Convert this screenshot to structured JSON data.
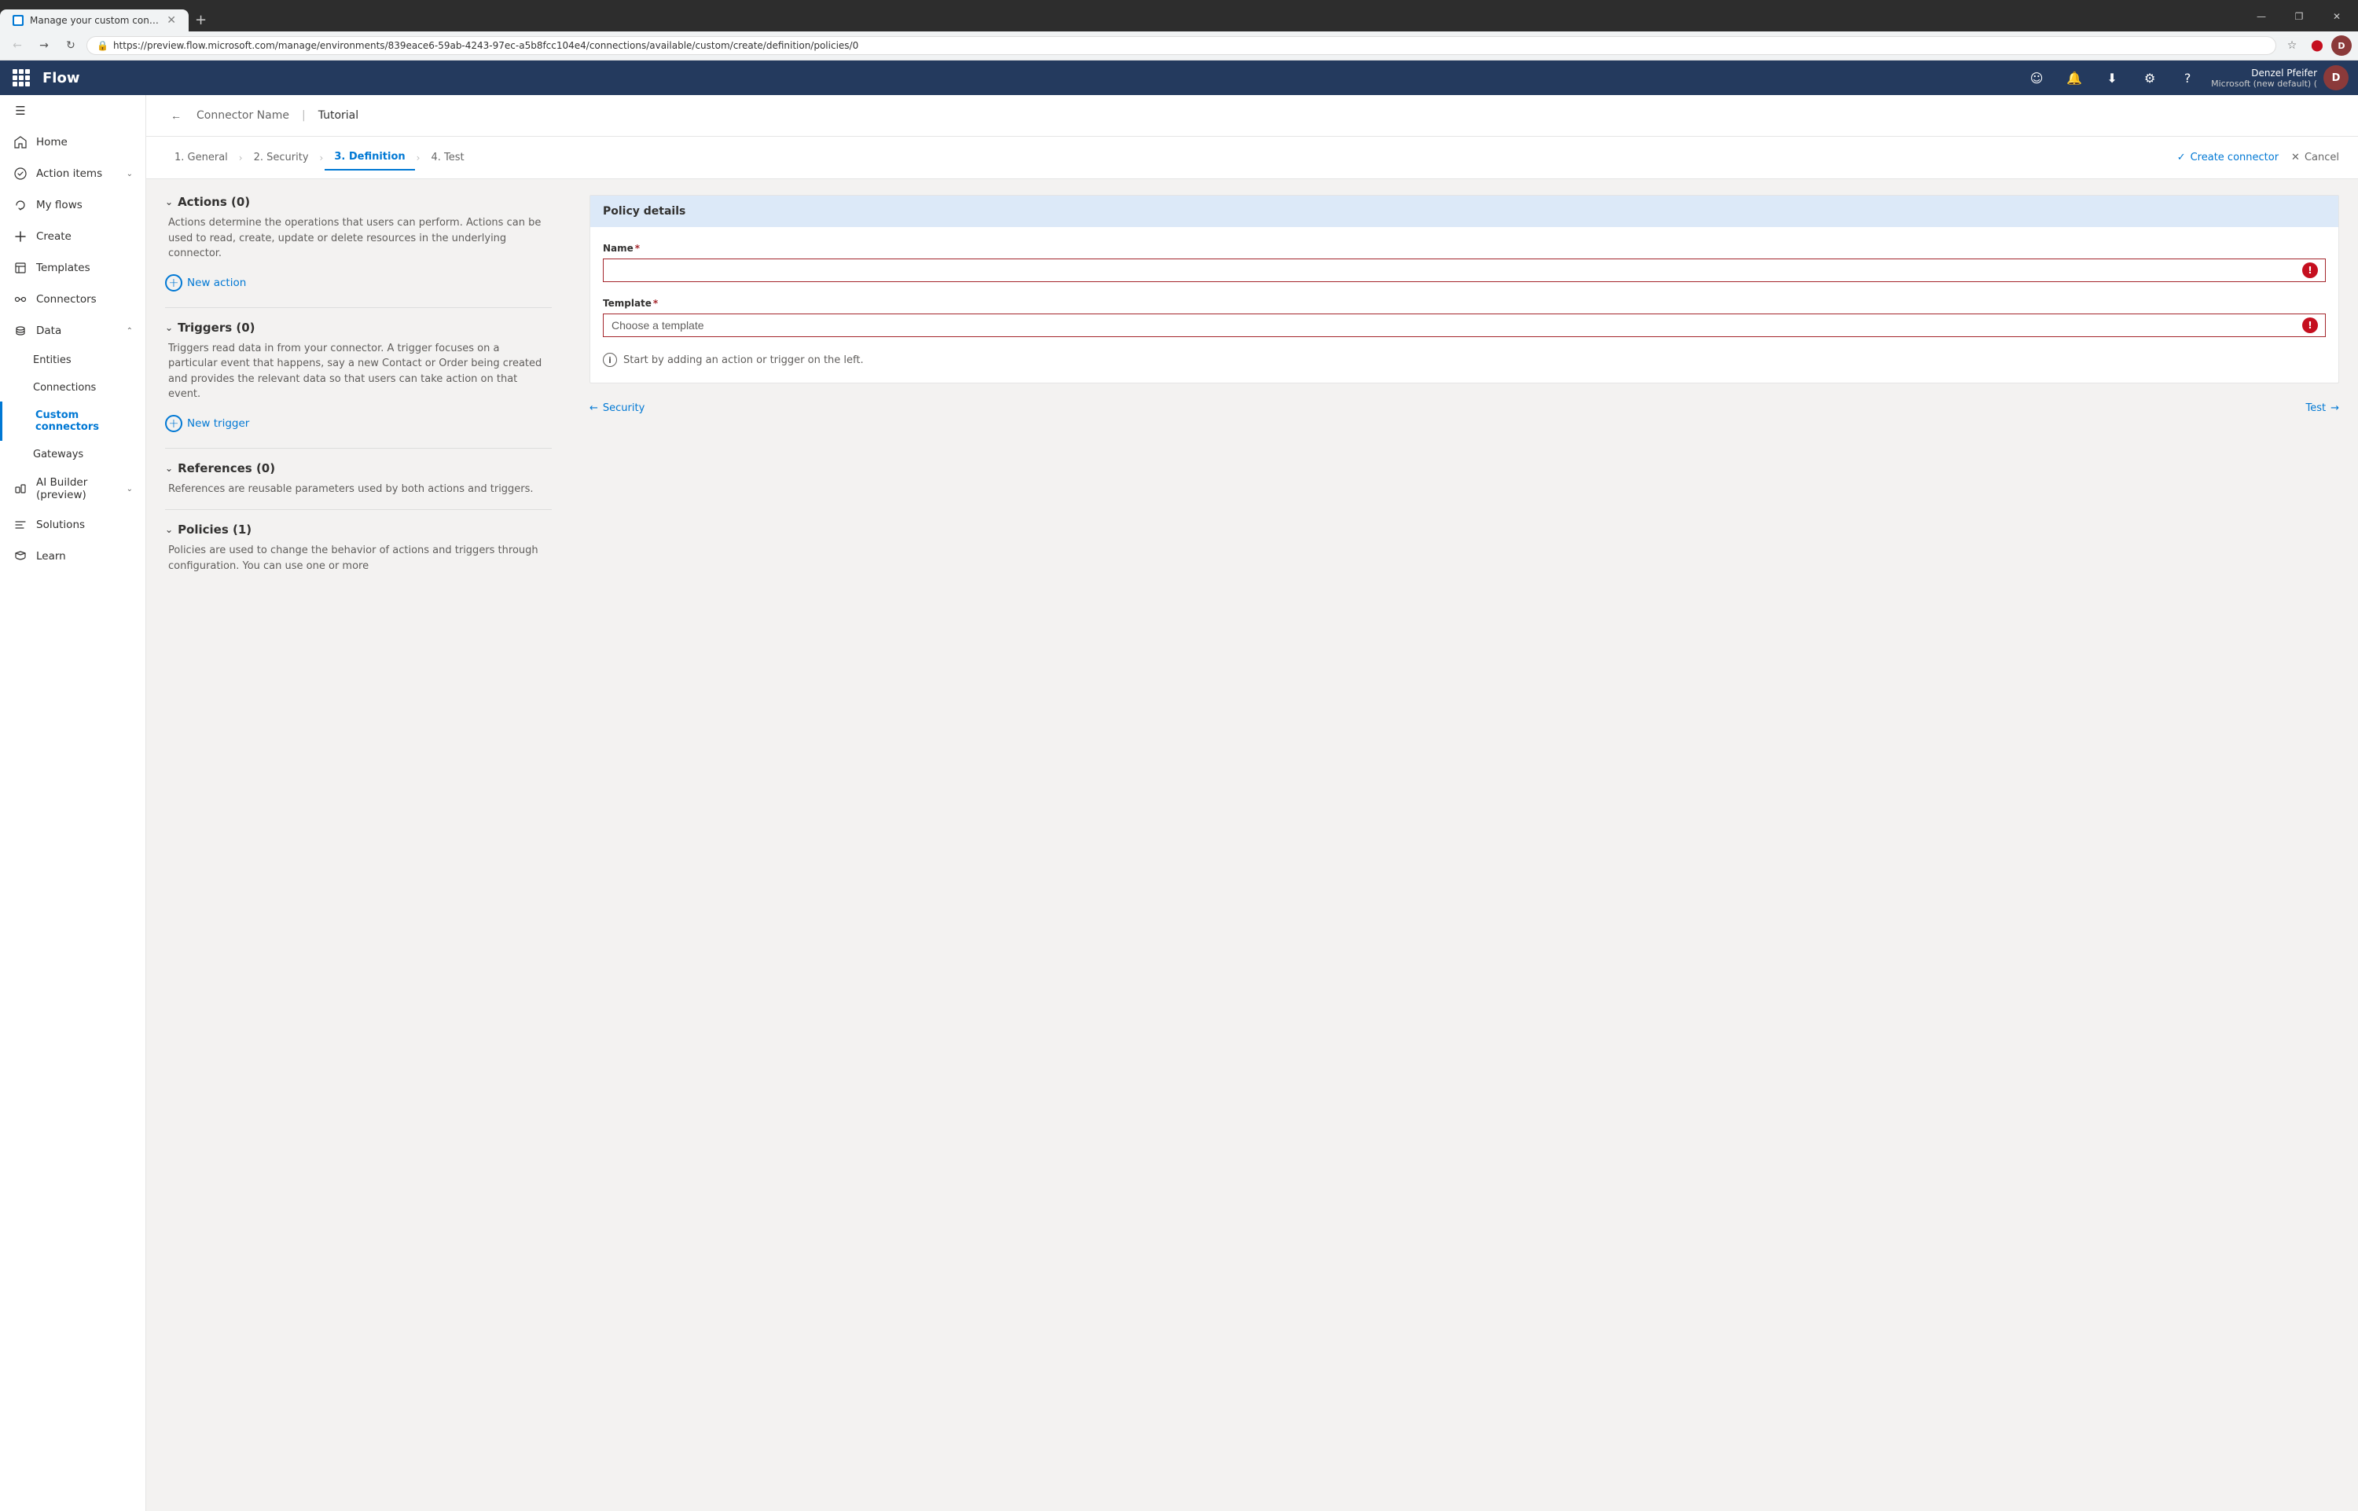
{
  "browser": {
    "tab_title": "Manage your custom connectors",
    "url": "https://preview.flow.microsoft.com/manage/environments/839eace6-59ab-4243-97ec-a5b8fcc104e4/connections/available/custom/create/definition/policies/0",
    "new_tab_label": "+",
    "window_controls": {
      "minimize": "—",
      "maximize": "❐",
      "close": "✕"
    }
  },
  "topbar": {
    "app_name": "Flow",
    "icons": {
      "smiley": "☺",
      "bell": "🔔",
      "download": "⬇",
      "settings": "⚙",
      "help": "?"
    },
    "user": {
      "name": "Denzel Pfeifer",
      "tenant": "Microsoft (new default) (",
      "initials": "D"
    }
  },
  "sidebar": {
    "items": [
      {
        "id": "menu",
        "label": "",
        "icon": "☰",
        "type": "icon-only"
      },
      {
        "id": "home",
        "label": "Home",
        "icon": "🏠"
      },
      {
        "id": "action-items",
        "label": "Action items",
        "icon": "✓",
        "hasChevron": true
      },
      {
        "id": "my-flows",
        "label": "My flows",
        "icon": "↻"
      },
      {
        "id": "create",
        "label": "Create",
        "icon": "+"
      },
      {
        "id": "templates",
        "label": "Templates",
        "icon": "📋"
      },
      {
        "id": "connectors",
        "label": "Connectors",
        "icon": "🔗"
      },
      {
        "id": "data",
        "label": "Data",
        "icon": "📊",
        "hasChevron": true,
        "expanded": true
      },
      {
        "id": "entities",
        "label": "Entities",
        "icon": "",
        "sub": true
      },
      {
        "id": "connections",
        "label": "Connections",
        "icon": "",
        "sub": true
      },
      {
        "id": "custom-connectors",
        "label": "Custom connectors",
        "icon": "",
        "sub": true,
        "active": true
      },
      {
        "id": "gateways",
        "label": "Gateways",
        "icon": "",
        "sub": true
      },
      {
        "id": "ai-builder",
        "label": "AI Builder (preview)",
        "icon": "🤖",
        "hasChevron": true
      },
      {
        "id": "solutions",
        "label": "Solutions",
        "icon": "🧩"
      },
      {
        "id": "learn",
        "label": "Learn",
        "icon": "📖"
      }
    ]
  },
  "page_header": {
    "back_icon": "←",
    "connector_name": "Connector Name",
    "separator": "",
    "tutorial": "Tutorial"
  },
  "wizard": {
    "steps": [
      {
        "id": "general",
        "label": "1. General",
        "active": false
      },
      {
        "id": "security",
        "label": "2. Security",
        "active": false
      },
      {
        "id": "definition",
        "label": "3. Definition",
        "active": true
      },
      {
        "id": "test",
        "label": "4. Test",
        "active": false
      }
    ],
    "create_connector": "Create connector",
    "cancel": "Cancel",
    "check_icon": "✓",
    "x_icon": "✕"
  },
  "left_panel": {
    "actions_section": {
      "title": "Actions (0)",
      "description": "Actions determine the operations that users can perform. Actions can be used to read, create, update or delete resources in the underlying connector.",
      "new_action_label": "New action"
    },
    "triggers_section": {
      "title": "Triggers (0)",
      "description": "Triggers read data in from your connector. A trigger focuses on a particular event that happens, say a new Contact or Order being created and provides the relevant data so that users can take action on that event.",
      "new_trigger_label": "New trigger"
    },
    "references_section": {
      "title": "References (0)",
      "description": "References are reusable parameters used by both actions and triggers."
    },
    "policies_section": {
      "title": "Policies (1)",
      "description": "Policies are used to change the behavior of actions and triggers through configuration. You can use one or more"
    }
  },
  "right_panel": {
    "policy_details": {
      "header": "Policy details",
      "name_label": "Name",
      "name_required": "*",
      "name_value": "",
      "template_label": "Template",
      "template_required": "*",
      "template_placeholder": "Choose a template",
      "info_message": "Start by adding an action or trigger on the left."
    },
    "bottom_nav": {
      "back_label": "Security",
      "back_icon": "←",
      "forward_label": "Test",
      "forward_icon": "→"
    }
  }
}
